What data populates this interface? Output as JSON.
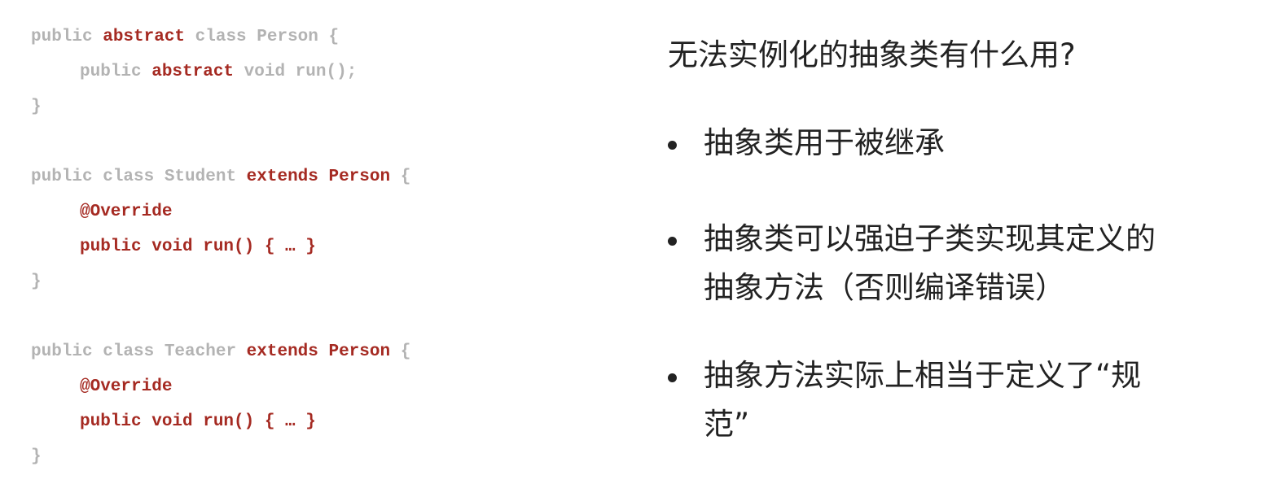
{
  "code": {
    "blocks": [
      {
        "lines": [
          {
            "indent": false,
            "tokens": [
              {
                "text": "public ",
                "hl": false
              },
              {
                "text": "abstract",
                "hl": true
              },
              {
                "text": " class Person {",
                "hl": false
              }
            ]
          },
          {
            "indent": true,
            "tokens": [
              {
                "text": "public ",
                "hl": false
              },
              {
                "text": "abstract",
                "hl": true
              },
              {
                "text": " void run();",
                "hl": false
              }
            ]
          },
          {
            "indent": false,
            "tokens": [
              {
                "text": "}",
                "hl": false
              }
            ]
          }
        ]
      },
      {
        "lines": [
          {
            "indent": false,
            "tokens": [
              {
                "text": "public class Student ",
                "hl": false
              },
              {
                "text": "extends Person",
                "hl": true
              },
              {
                "text": " {",
                "hl": false
              }
            ]
          },
          {
            "indent": true,
            "tokens": [
              {
                "text": "@Override",
                "hl": true
              }
            ]
          },
          {
            "indent": true,
            "tokens": [
              {
                "text": "public void run() { … }",
                "hl": true
              }
            ]
          },
          {
            "indent": false,
            "tokens": [
              {
                "text": "}",
                "hl": false
              }
            ]
          }
        ]
      },
      {
        "lines": [
          {
            "indent": false,
            "tokens": [
              {
                "text": "public class Teacher ",
                "hl": false
              },
              {
                "text": "extends Person",
                "hl": true
              },
              {
                "text": " {",
                "hl": false
              }
            ]
          },
          {
            "indent": true,
            "tokens": [
              {
                "text": "@Override",
                "hl": true
              }
            ]
          },
          {
            "indent": true,
            "tokens": [
              {
                "text": "public void run() { … }",
                "hl": true
              }
            ]
          },
          {
            "indent": false,
            "tokens": [
              {
                "text": "}",
                "hl": false
              }
            ]
          }
        ]
      }
    ]
  },
  "notes": {
    "heading": "无法实例化的抽象类有什么用?",
    "bullets": [
      {
        "lines": [
          "抽象类用于被继承"
        ]
      },
      {
        "lines": [
          "抽象类可以强迫子类实现其定义的",
          "抽象方法（否则编译错误）"
        ]
      },
      {
        "lines": [
          "抽象方法实际上相当于定义了“规",
          "范”"
        ]
      }
    ]
  },
  "colors": {
    "keyword_highlight": "#a52a22",
    "code_muted": "#b3b3b3",
    "text": "#222222",
    "background": "#ffffff"
  }
}
